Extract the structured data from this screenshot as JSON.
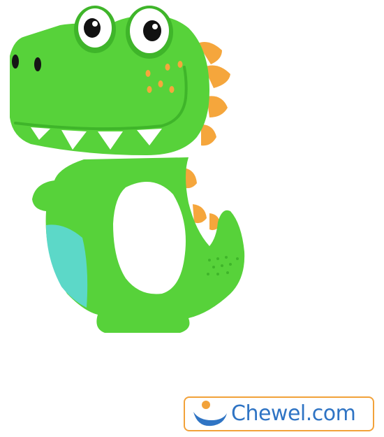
{
  "product": {
    "name": "dinosaur-teether",
    "colors": {
      "body": "#57d23a",
      "body_dark": "#3fb52a",
      "belly": "#5cd8c8",
      "spikes": "#f5a63c",
      "teeth": "#ffffff",
      "eyes_white": "#ffffff",
      "pupil": "#111111"
    }
  },
  "watermark": {
    "text": "Chewel.com",
    "icon": "smile-logo-icon",
    "colors": {
      "border": "#f2a23a",
      "text": "#2f74c4",
      "dot": "#f2a23a",
      "smile": "#2f74c4"
    }
  }
}
